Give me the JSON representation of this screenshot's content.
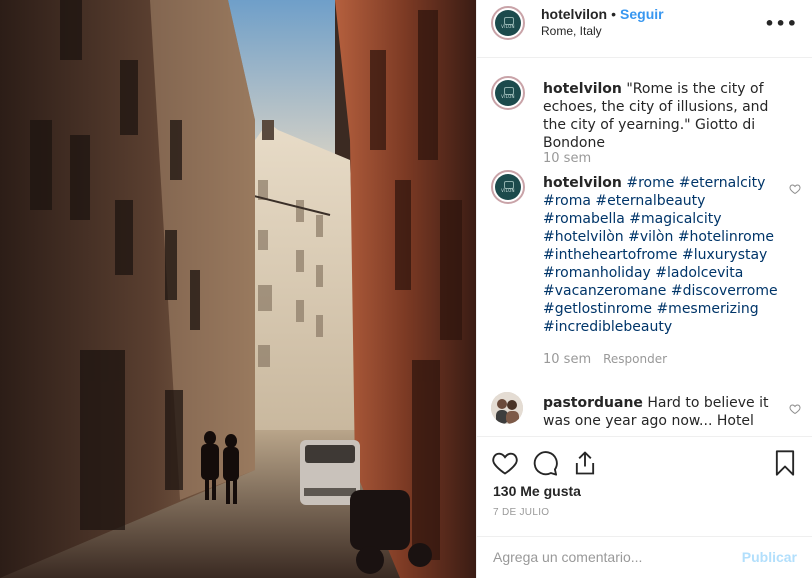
{
  "header": {
    "username": "hotelvilon",
    "dot": "•",
    "follow_label": "Seguir",
    "location": "Rome, Italy",
    "more_icon": "ellipsis-icon",
    "avatar_tag": "VILON"
  },
  "caption": {
    "username": "hotelvilon",
    "text": " \"Rome is the city of echoes, the city of illusions, and the city of yearning.\" Giotto di Bondone",
    "time": "10 sem"
  },
  "hashtag_comment": {
    "username": "hotelvilon",
    "hashtags": [
      "#rome",
      "#eternalcity",
      "#roma",
      "#eternalbeauty",
      "#romabella",
      "#magicalcity",
      "#hotelvilòn",
      "#vilòn",
      "#hotelinrome",
      "#intheheartofrome",
      "#luxurystay",
      "#romanholiday",
      "#ladolcevita",
      "#vacanzeromane",
      "#discoverrome",
      "#getlostinrome",
      "#mesmerizing",
      "#incrediblebeauty"
    ],
    "time": "10 sem",
    "reply_label": "Responder"
  },
  "user_comment": {
    "username": "pastorduane",
    "text": " Hard to believe it was one year ago now... Hotel"
  },
  "actions": {
    "likes": "130 Me gusta",
    "date": "7 DE JULIO",
    "icons": [
      "heart-icon",
      "comment-icon",
      "share-icon",
      "bookmark-icon"
    ]
  },
  "add_comment": {
    "placeholder": "Agrega un comentario...",
    "publish_label": "Publicar"
  },
  "colors": {
    "link_blue": "#3897f0",
    "hashtag": "#003569",
    "muted": "#999999",
    "publish_disabled": "#b2dffc",
    "brand_teal": "#1c4a4c"
  }
}
